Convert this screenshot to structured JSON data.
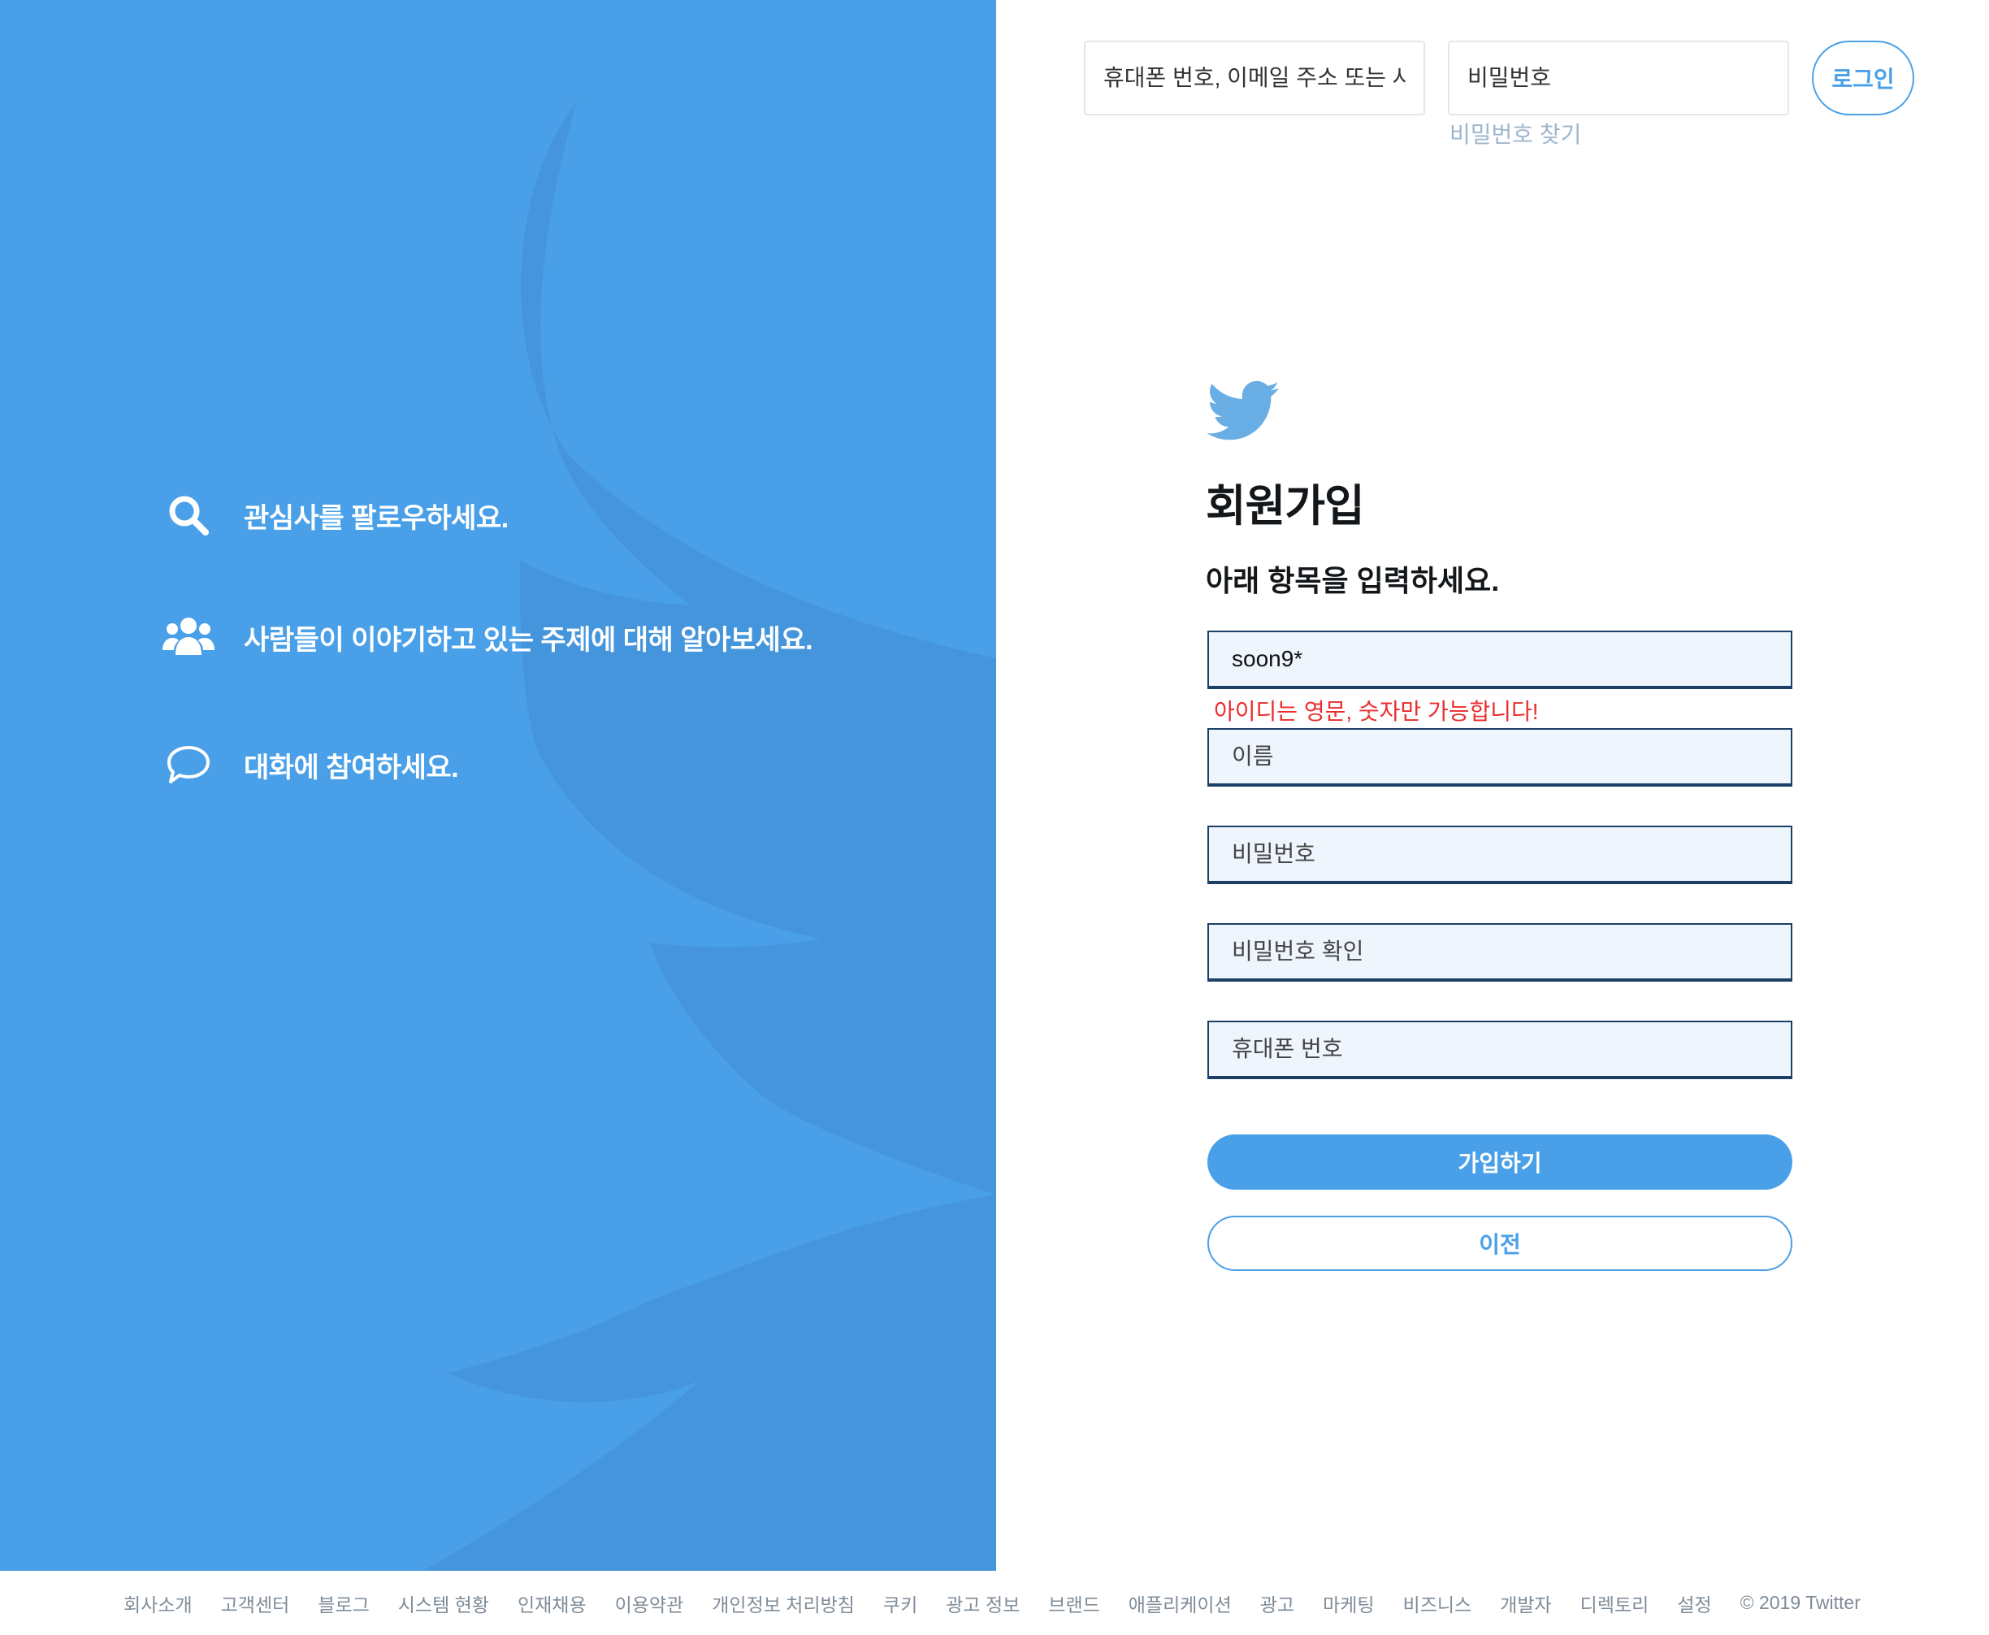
{
  "colors": {
    "brand_blue": "#4aa0e8",
    "bird_shadow": "#4495dc",
    "input_bg": "#eef5fd",
    "input_border": "#1c3f66",
    "error_red": "#ea2d2d",
    "footer_text": "#7f8c98"
  },
  "left": {
    "features": [
      {
        "icon": "search-icon",
        "text": "관심사를 팔로우하세요."
      },
      {
        "icon": "people-icon",
        "text": "사람들이 이야기하고 있는 주제에 대해 알아보세요."
      },
      {
        "icon": "speech-bubble-icon",
        "text": "대화에 참여하세요."
      }
    ]
  },
  "login": {
    "id_placeholder": "휴대폰 번호, 이메일 주소 또는 사용자 아이디",
    "password_placeholder": "비밀번호",
    "forgot_password": "비밀번호 찾기",
    "login_button": "로그인"
  },
  "signup": {
    "logo_icon": "twitter-bird-icon",
    "title": "회원가입",
    "subtitle": "아래 항목을 입력하세요.",
    "userid_value": "soon9*",
    "userid_error": "아이디는 영문, 숫자만 가능합니다!",
    "name_placeholder": "이름",
    "password_placeholder": "비밀번호",
    "password_confirm_placeholder": "비밀번호 확인",
    "phone_placeholder": "휴대폰 번호",
    "submit_button": "가입하기",
    "back_button": "이전"
  },
  "footer": {
    "links": [
      "회사소개",
      "고객센터",
      "블로그",
      "시스템 현황",
      "인재채용",
      "이용약관",
      "개인정보 처리방침",
      "쿠키",
      "광고 정보",
      "브랜드",
      "애플리케이션",
      "광고",
      "마케팅",
      "비즈니스",
      "개발자",
      "디렉토리",
      "설정"
    ],
    "copyright": "© 2019 Twitter"
  }
}
